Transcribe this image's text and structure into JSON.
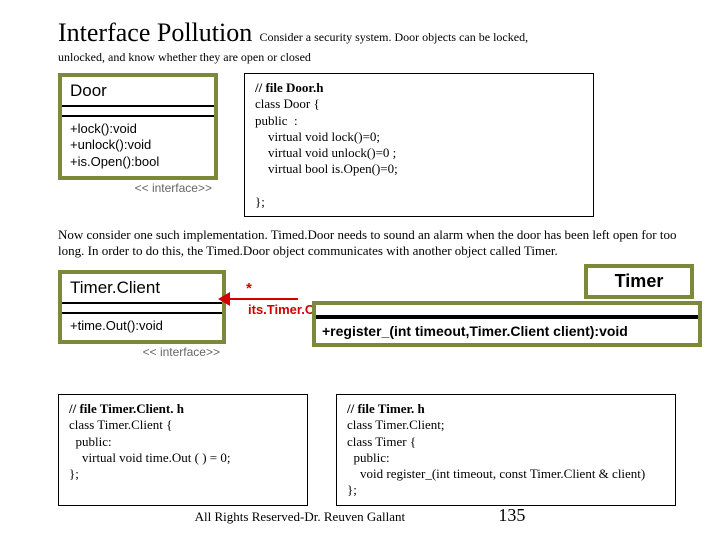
{
  "title": "Interface Pollution",
  "subtitle_inline": "Consider a security system. Door objects can be locked,",
  "subtitle_line2": "unlocked, and know whether they are open or closed",
  "uml_door": {
    "name": "Door",
    "ops": "+lock():void\n+unlock():void\n+is.Open():bool",
    "tag": "<< interface>>"
  },
  "code_door": {
    "header": "// file Door.h",
    "body": "class Door {\npublic  :\n    virtual void lock()=0;\n    virtual void unlock()=0 ;\n    virtual bool is.Open()=0;\n\n};"
  },
  "para2": "Now consider one such implementation. Timed.Door needs to sound an alarm when the door has been left open for too long.  In order to do this, the Timed.Door object communicates with another object called Timer.",
  "uml_tc": {
    "name": "Timer.Client",
    "ops": "+time.Out():void",
    "tag": "<< interface>>"
  },
  "uml_timer": {
    "name": "Timer",
    "ops": "+register_(int timeout,Timer.Client client):void"
  },
  "assoc": {
    "mult": "*",
    "name": "its.Timer.Client"
  },
  "code_tc": {
    "header": "// file Timer.Client. h",
    "body": "class Timer.Client {\n  public:\n    virtual void time.Out ( ) = 0;\n};"
  },
  "code_timer": {
    "header": "// file Timer. h",
    "body": "class Timer.Client;\nclass Timer {\n  public:\n    void register_(int timeout, const Timer.Client & client)\n};"
  },
  "footer": "All Rights Reserved-Dr. Reuven Gallant",
  "page": "135"
}
